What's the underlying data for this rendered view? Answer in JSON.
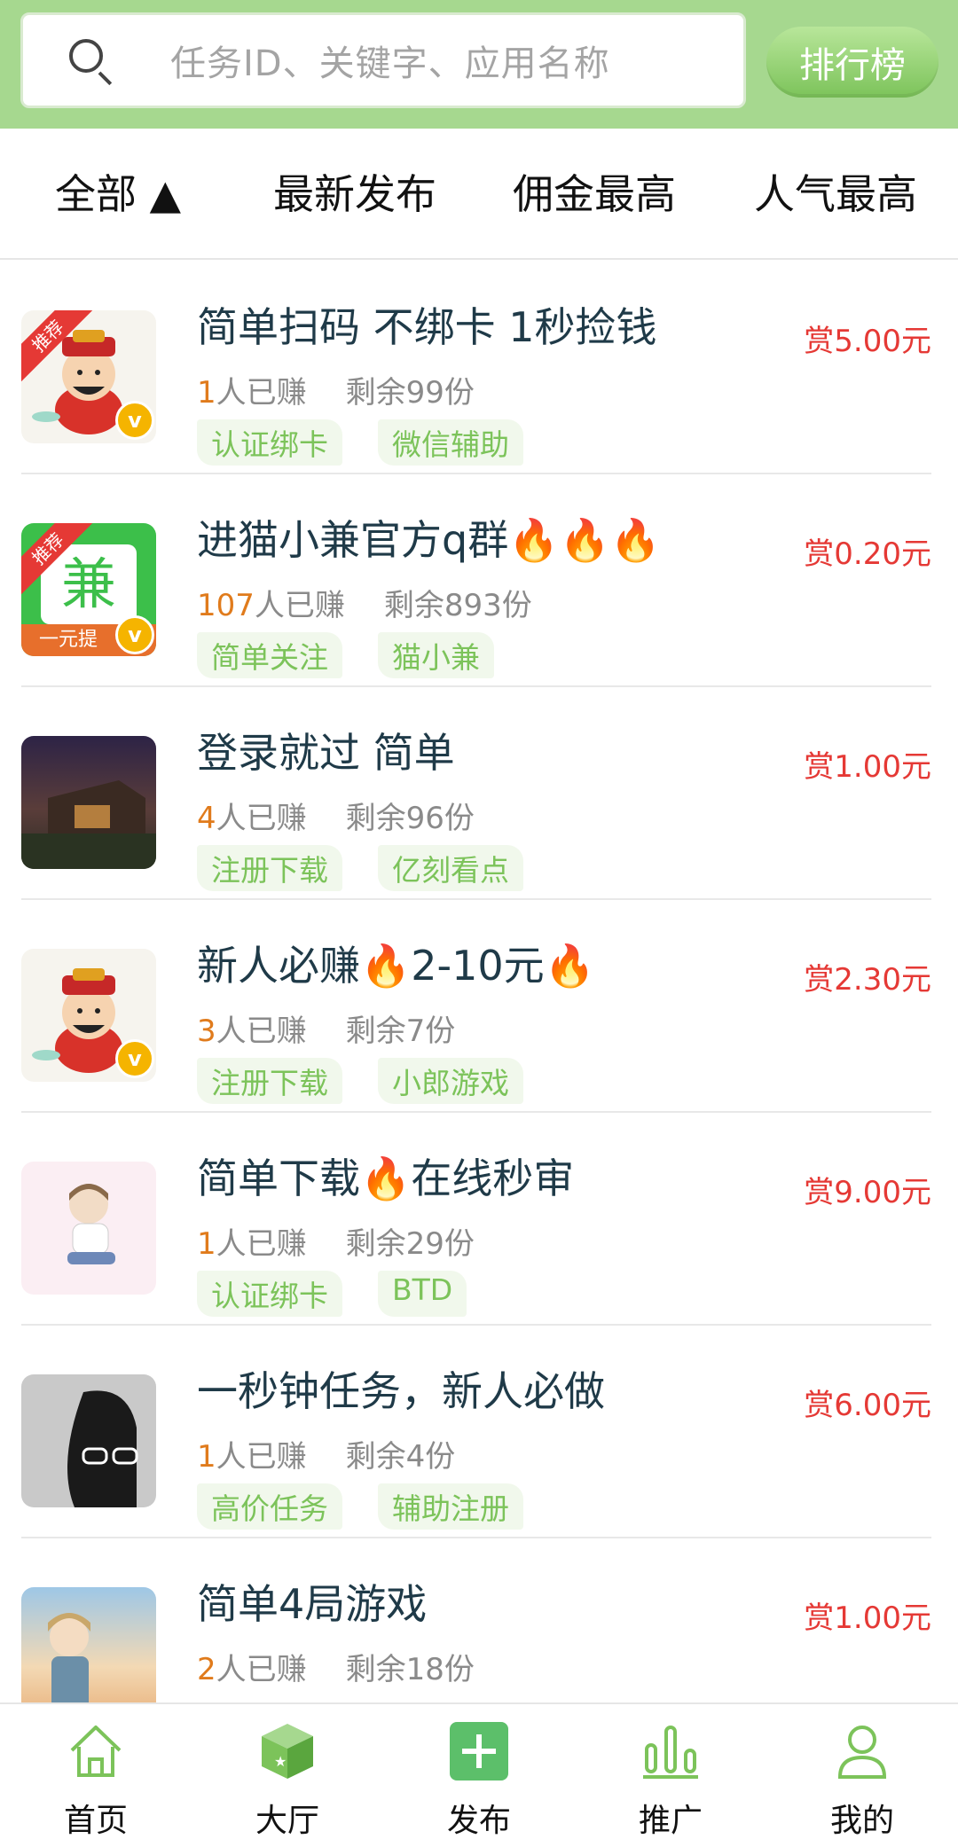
{
  "search": {
    "placeholder": "任务ID、关键字、应用名称",
    "rank_label": "排行榜"
  },
  "tabs": [
    {
      "label": "全部 ▲"
    },
    {
      "label": "最新发布"
    },
    {
      "label": "佣金最高"
    },
    {
      "label": "人气最高"
    }
  ],
  "tasks": [
    {
      "title": "简单扫码 不绑卡 1秒捡钱",
      "count": "1",
      "earned": "人已赚",
      "remaining": "剩余99份",
      "tags": [
        "认证绑卡",
        "微信辅助"
      ],
      "reward": "赏5.00元",
      "ribbon": "推荐",
      "thumb": "caishen-icon"
    },
    {
      "title": "进猫小兼官方q群🔥🔥🔥",
      "count": "107",
      "earned": "人已赚",
      "remaining": "剩余893份",
      "tags": [
        "简单关注",
        "猫小兼"
      ],
      "reward": "赏0.20元",
      "ribbon": "推荐",
      "thumb_text": "兼",
      "thumb_sub": "一元提",
      "thumb": "jian-app-icon"
    },
    {
      "title": "登录就过 简单",
      "count": "4",
      "earned": "人已赚",
      "remaining": "剩余96份",
      "tags": [
        "注册下载",
        "亿刻看点"
      ],
      "reward": "赏1.00元",
      "thumb": "night-scene-icon"
    },
    {
      "title": "新人必赚🔥2-10元🔥",
      "count": "3",
      "earned": "人已赚",
      "remaining": "剩余7份",
      "tags": [
        "注册下载",
        "小郎游戏"
      ],
      "reward": "赏2.30元",
      "thumb": "caishen-icon"
    },
    {
      "title": "简单下载🔥在线秒审",
      "count": "1",
      "earned": "人已赚",
      "remaining": "剩余29份",
      "tags": [
        "认证绑卡",
        "BTD"
      ],
      "reward": "赏9.00元",
      "thumb": "cartoon-boy-icon"
    },
    {
      "title": "一秒钟任务，新人必做",
      "count": "1",
      "earned": "人已赚",
      "remaining": "剩余4份",
      "tags": [
        "高价任务",
        "辅助注册"
      ],
      "reward": "赏6.00元",
      "thumb": "man-glasses-icon"
    },
    {
      "title": "简单4局游戏",
      "count": "2",
      "earned": "人已赚",
      "remaining": "剩余18份",
      "tags": [],
      "reward": "赏1.00元",
      "thumb": "anime-character-icon"
    }
  ],
  "bottom_nav": [
    {
      "label": "首页",
      "icon": "home-icon"
    },
    {
      "label": "大厅",
      "icon": "cube-icon"
    },
    {
      "label": "发布",
      "icon": "plus-icon"
    },
    {
      "label": "推广",
      "icon": "bars-icon"
    },
    {
      "label": "我的",
      "icon": "user-icon"
    }
  ],
  "colors": {
    "brand_green": "#a6d88f",
    "tag_green": "#7cc35a",
    "reward_red": "#e53935",
    "count_orange": "#e07b1c"
  }
}
